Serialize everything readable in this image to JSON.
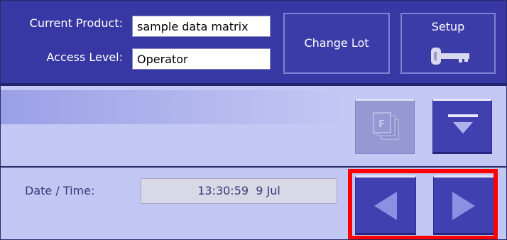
{
  "header": {
    "current_product_label": "Current Product:",
    "current_product_value": "sample data matrix",
    "access_level_label": "Access Level:",
    "access_level_value": "Operator",
    "change_lot_label": "Change Lot",
    "setup_label": "Setup",
    "setup_icon": "key-icon"
  },
  "toolbar": {
    "files_button_icon": "files-icon",
    "files_button_enabled": false,
    "dropdown_button_icon": "dropdown-icon"
  },
  "footer": {
    "datetime_label": "Date / Time:",
    "datetime_value": "13:30:59  9 Jul",
    "prev_icon": "left-arrow-icon",
    "next_icon": "right-arrow-icon",
    "highlight_color": "#ff0000"
  },
  "colors": {
    "header_bg": "#3838a4",
    "body_bg": "#c4c8f4",
    "button_bg": "#4040b0",
    "disabled_button_bg": "#9698d4",
    "text_dark": "#3a3a7a"
  }
}
